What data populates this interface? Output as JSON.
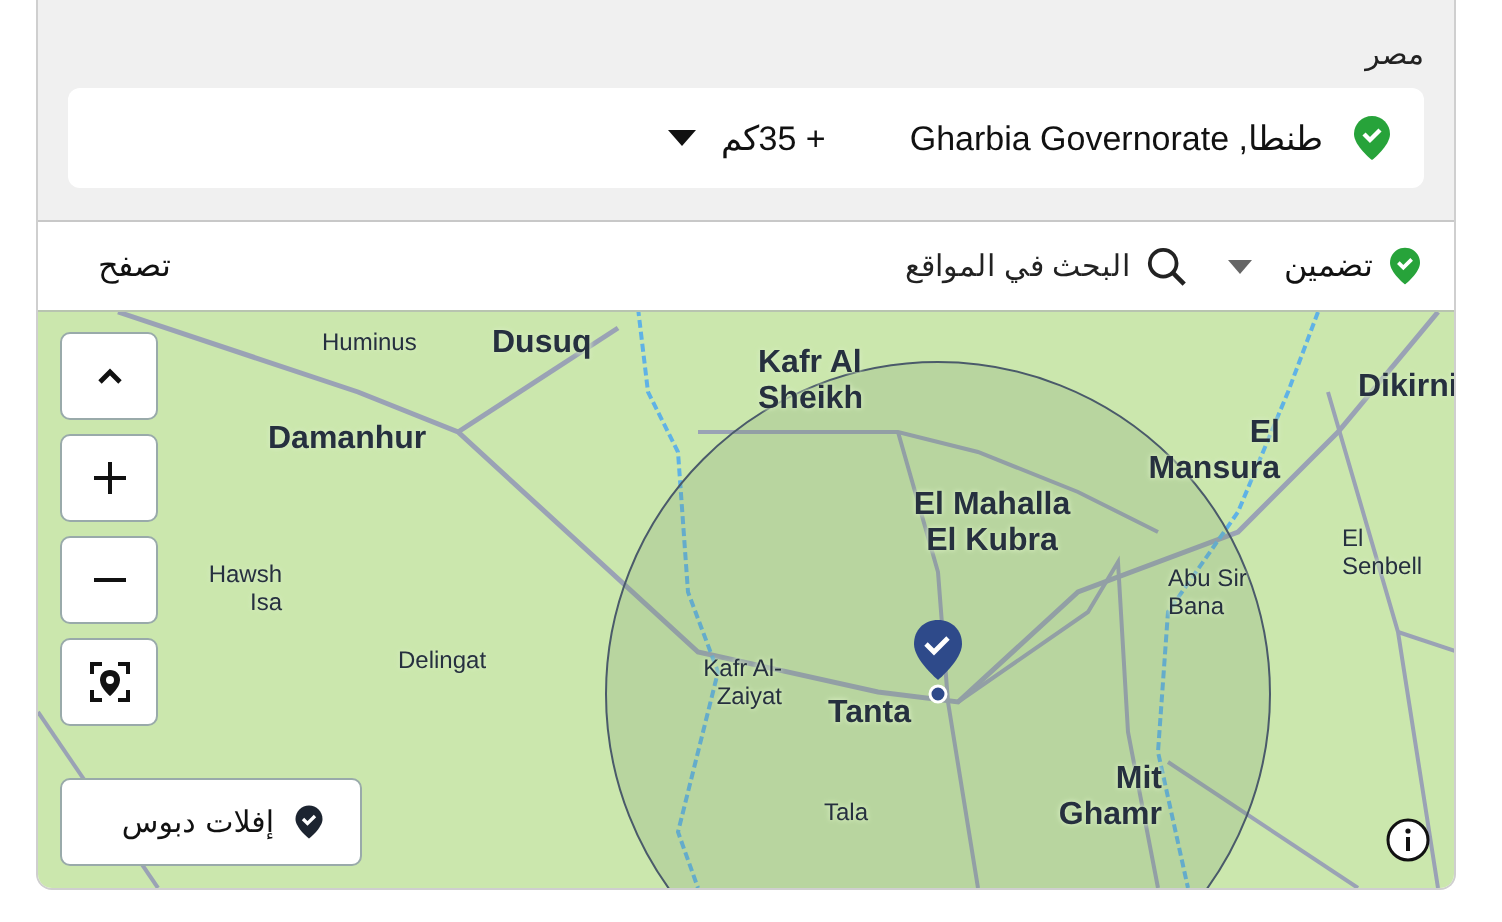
{
  "header": {
    "country": "مصر"
  },
  "location": {
    "name": "طنطا, Gharbia Governorate",
    "radius": "+ 35كم"
  },
  "toolbar": {
    "include": "تضمين",
    "search": {
      "placeholder": "البحث في المواقع"
    },
    "browse": "تصفح"
  },
  "map": {
    "drop_pin": "إفلات دبوس",
    "places": [
      {
        "name": "Huminus",
        "kind": "town"
      },
      {
        "name": "Dusuq",
        "kind": "city"
      },
      {
        "name": "Kafr Al Sheikh",
        "kind": "city"
      },
      {
        "name": "Dikirni",
        "kind": "city"
      },
      {
        "name": "Damanhur",
        "kind": "city"
      },
      {
        "name": "El Mansura",
        "kind": "city"
      },
      {
        "name": "El Mahalla El Kubra",
        "kind": "city"
      },
      {
        "name": "Hawsh Isa",
        "kind": "town"
      },
      {
        "name": "Abu Sir Bana",
        "kind": "town"
      },
      {
        "name": "El Senbell",
        "kind": "town"
      },
      {
        "name": "Delingat",
        "kind": "town"
      },
      {
        "name": "Kafr Al- Zaiyat",
        "kind": "town"
      },
      {
        "name": "Tanta",
        "kind": "city"
      },
      {
        "name": "Tala",
        "kind": "town"
      },
      {
        "name": "Mit Ghamr",
        "kind": "city"
      }
    ]
  }
}
